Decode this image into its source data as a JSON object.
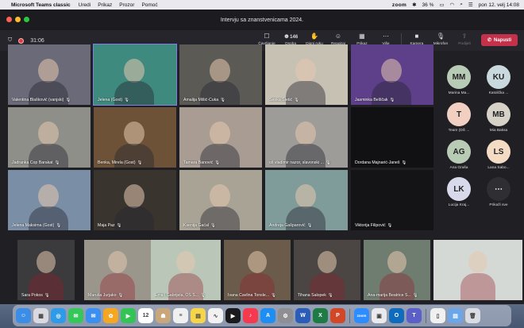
{
  "menubar": {
    "app": "Microsoft Teams classic",
    "menus": [
      "Uredi",
      "Prikaz",
      "Prozor",
      "Pomoć"
    ],
    "zoom": "zoom",
    "battery": "36 %",
    "datetime": "pon 12. velj  14:08"
  },
  "meeting": {
    "title": "Intervju sa znanstvenicama 2024.",
    "timer": "31:06",
    "participants_count": "146"
  },
  "toolbar": {
    "buttons": [
      {
        "label": "Čavrljanje",
        "icon": "chat-icon"
      },
      {
        "label": "Osoba",
        "icon": "people-icon"
      },
      {
        "label": "Digni ruku",
        "icon": "hand-icon"
      },
      {
        "label": "Reagiraj",
        "icon": "smile-icon"
      },
      {
        "label": "Prikaz",
        "icon": "grid-icon"
      },
      {
        "label": "Više",
        "icon": "more-icon"
      },
      {
        "label": "Kamera",
        "icon": "camera-icon"
      },
      {
        "label": "Mikrofon",
        "icon": "mic-icon"
      },
      {
        "label": "Podijeli",
        "icon": "share-icon"
      }
    ],
    "leave": "Napusti"
  },
  "tiles": [
    {
      "name": "Valentina Blašković (vanjski)",
      "bg": "#6b6a78"
    },
    {
      "name": "Jelena (Gost)",
      "bg": "#3e8a7e"
    },
    {
      "name": "Amalija Mišić-Čuka",
      "bg": "#5b5a55"
    },
    {
      "name": "Senka Štetić",
      "bg": "#c7c1b4"
    },
    {
      "name": "Jasminka Belščak",
      "bg": "#5e3f8a"
    },
    {
      "name": "Jadranka Čop Barakat",
      "bg": "#8f8f8a"
    },
    {
      "name": "Benka, Mirela (Gost)",
      "bg": "#6e5238"
    },
    {
      "name": "Tamara Banović",
      "bg": "#a89c93"
    },
    {
      "name": "oš vladimir nazor, slavonski ...",
      "bg": "#9d9c98"
    },
    {
      "name": "Dordana Majnarić-Janeš",
      "bg": "#111114"
    },
    {
      "name": "Jelena Maksima (Gost)",
      "bg": "#7a8fa6"
    },
    {
      "name": "Maja Paz",
      "bg": "#3a342f"
    },
    {
      "name": "Ksenija Gaćal",
      "bg": "#a9a396"
    },
    {
      "name": "Andreja Gašparović",
      "bg": "#7f9b9a"
    },
    {
      "name": "Viktorija Filipović",
      "bg": "#141416"
    }
  ],
  "bottom_tiles": [
    {
      "name": "Sara Pokos",
      "bg": "#3b3b3e"
    },
    {
      "name": "Maruša Jurjako",
      "bg": "#9a968c"
    },
    {
      "name": "Ema i Gabrijela, OŠ S...",
      "bg": "#b9c6b8"
    },
    {
      "name": "Ivana Čavlina Tonsle...",
      "bg": "#6b5b4a"
    },
    {
      "name": "Tihana Salopek",
      "bg": "#4b4644"
    },
    {
      "name": "Ana-marija Beatrice S...",
      "bg": "#6f7c70"
    },
    {
      "name": "",
      "bg": "#d5d9d6"
    }
  ],
  "roster": [
    {
      "initials": "MM",
      "name": "Marina Ma...",
      "color": "#b7cbb5"
    },
    {
      "initials": "KU",
      "name": "Katolička ...",
      "color": "#c8d8dc"
    },
    {
      "initials": "T",
      "name": "Team (DŠ ...",
      "color": "#f2d0c1"
    },
    {
      "initials": "MB",
      "name": "Mia Baksa",
      "color": "#d7d2c8"
    },
    {
      "initials": "AG",
      "name": "Ana Graša",
      "color": "#b7cbb5"
    },
    {
      "initials": "LS",
      "name": "Lana Sabo...",
      "color": "#f3dcc3"
    },
    {
      "initials": "LK",
      "name": "Lucija Kraj...",
      "color": "#d8d9ea"
    },
    {
      "initials": "⋯",
      "name": "Prikaži sve",
      "color": "#2e2e33"
    }
  ],
  "dock": {
    "items": [
      {
        "icon": "finder-icon",
        "color": "#3b8de6",
        "glyph": "☺"
      },
      {
        "icon": "launchpad-icon",
        "color": "#d9d9df",
        "glyph": "▦"
      },
      {
        "icon": "safari-icon",
        "color": "#2f9be8",
        "glyph": "◎"
      },
      {
        "icon": "messages-icon",
        "color": "#35c759",
        "glyph": "✉"
      },
      {
        "icon": "mail-icon",
        "color": "#3a8ff0",
        "glyph": "✉"
      },
      {
        "icon": "photos-icon",
        "color": "#f5a623",
        "glyph": "✿"
      },
      {
        "icon": "facetime-icon",
        "color": "#33c455",
        "glyph": "▶"
      },
      {
        "icon": "calendar-icon",
        "color": "#ffffff",
        "glyph": "12"
      },
      {
        "icon": "contacts-icon",
        "color": "#c9a77b",
        "glyph": "☗"
      },
      {
        "icon": "reminders-icon",
        "color": "#f0f0f0",
        "glyph": "≡"
      },
      {
        "icon": "notes-icon",
        "color": "#f7d54a",
        "glyph": "▤"
      },
      {
        "icon": "freeform-icon",
        "color": "#f2f2f2",
        "glyph": "∿"
      },
      {
        "icon": "appletv-icon",
        "color": "#1b1b1e",
        "glyph": "▶"
      },
      {
        "icon": "music-icon",
        "color": "#f5394f",
        "glyph": "♪"
      },
      {
        "icon": "appstore-icon",
        "color": "#1f8ef3",
        "glyph": "A"
      },
      {
        "icon": "settings-icon",
        "color": "#8e8e93",
        "glyph": "⚙"
      },
      {
        "icon": "word-icon",
        "color": "#2b5cb8",
        "glyph": "W"
      },
      {
        "icon": "excel-icon",
        "color": "#1e7b45",
        "glyph": "X"
      },
      {
        "icon": "powerpoint-icon",
        "color": "#d24726",
        "glyph": "P"
      },
      {
        "icon": "zoom-app-icon",
        "color": "#2d8cff",
        "glyph": "zoom"
      },
      {
        "icon": "preview-icon",
        "color": "#e9e9ee",
        "glyph": "▣"
      },
      {
        "icon": "outlook-icon",
        "color": "#0f6cbd",
        "glyph": "O"
      },
      {
        "icon": "teams-icon",
        "color": "#5b5fc7",
        "glyph": "T"
      },
      {
        "icon": "document-icon",
        "color": "#f0f0f0",
        "glyph": "▯"
      },
      {
        "icon": "downloads-icon",
        "color": "#6aa6e8",
        "glyph": "▤"
      },
      {
        "icon": "trash-icon",
        "color": "#d9dde3",
        "glyph": "🗑"
      }
    ]
  }
}
